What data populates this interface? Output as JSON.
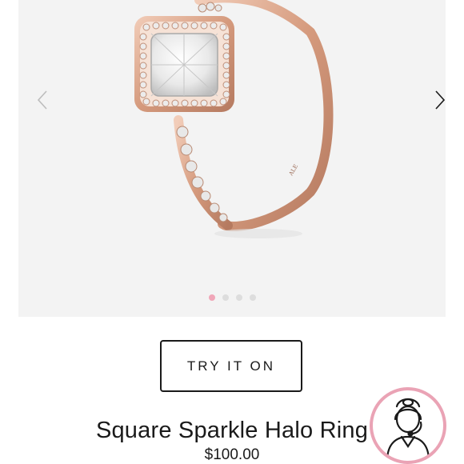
{
  "product": {
    "title": "Square Sparkle Halo Ring",
    "price": "$100.00",
    "try_on_label": "TRY IT ON"
  },
  "gallery": {
    "image_subject": "rose gold square halo ring",
    "slide_count": 4,
    "active_slide": 1,
    "prev_icon": "chevron-left-icon",
    "next_icon": "chevron-right-icon"
  },
  "support": {
    "icon": "customer-support-agent-icon"
  },
  "colors": {
    "accent_pink": "#eaa3b5",
    "active_dot": "#f0a6b8",
    "rose_gold": "#d9a085",
    "text": "#1a1a1a",
    "gallery_bg": "#f3f3f3"
  }
}
